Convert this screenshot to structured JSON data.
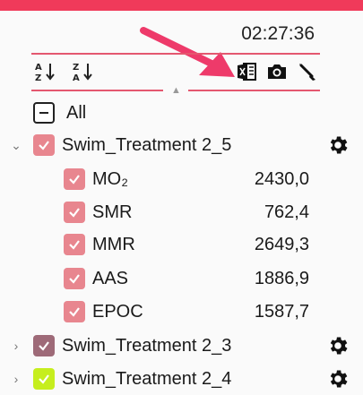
{
  "header": {
    "time": "02:27:36"
  },
  "toolbar": {
    "sort_az": "A Z",
    "sort_za": "Z A",
    "accent": "#e4576f"
  },
  "tree": {
    "all_label": "All",
    "groups": [
      {
        "name": "Swim_Treatment 2_5",
        "expanded": true,
        "color": "#e8868f",
        "items": [
          {
            "label": "MO₂",
            "value": "2430,0"
          },
          {
            "label": "SMR",
            "value": "762,4"
          },
          {
            "label": "MMR",
            "value": "2649,3"
          },
          {
            "label": "AAS",
            "value": "1886,9"
          },
          {
            "label": "EPOC",
            "value": "1587,7"
          }
        ]
      },
      {
        "name": "Swim_Treatment 2_3",
        "expanded": false,
        "color": "#9e6a78"
      },
      {
        "name": "Swim_Treatment 2_4",
        "expanded": false,
        "color": "#c6ee1e"
      }
    ]
  }
}
